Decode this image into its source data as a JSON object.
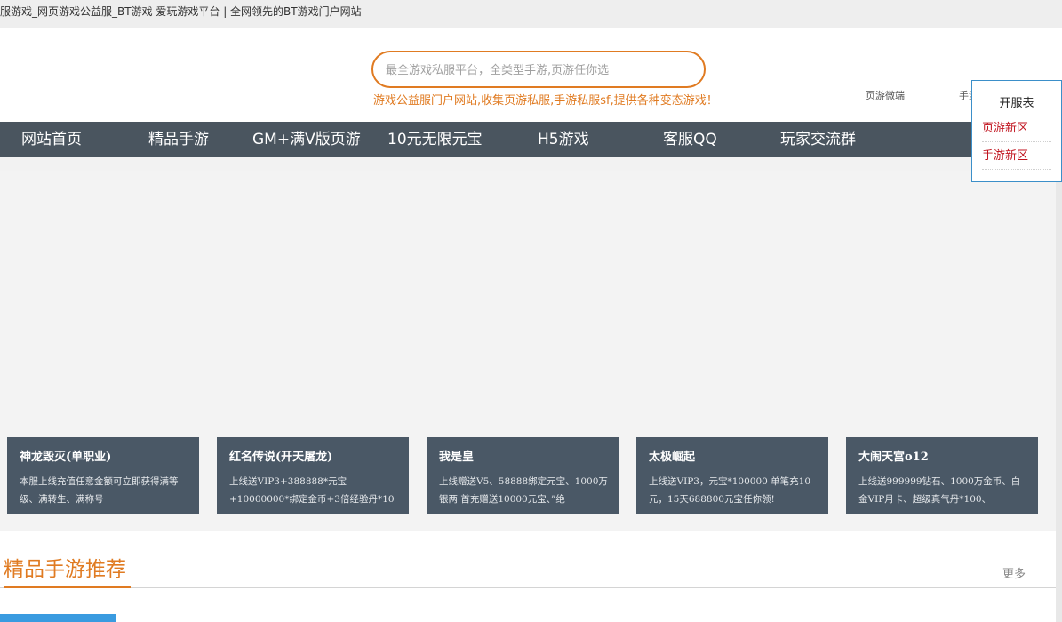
{
  "topbar": {
    "title": "服游戏_网页游戏公益服_BT游戏 爱玩游戏平台 | 全网领先的BT游戏门户网站"
  },
  "search": {
    "placeholder": "最全游戏私服平台，全类型手游,页游任你选"
  },
  "slogan": "游戏公益服门户网站,收集页游私服,手游私服sf,提供各种变态游戏！",
  "header_links": [
    "页游微端",
    "手游"
  ],
  "nav": [
    "网站首页",
    "精品手游",
    "GM+满V版页游",
    "10元无限元宝",
    "H5游戏",
    "客服QQ",
    "玩家交流群"
  ],
  "popup": {
    "title": "开服表",
    "links": [
      "页游新区",
      "手游新区"
    ]
  },
  "cards": [
    {
      "title": "神龙毁灭(单职业)",
      "desc": "本服上线充值任意金额可立即获得满等级、满转生、满称号"
    },
    {
      "title": "红名传说(开天屠龙)",
      "desc": "上线送VIP3+388888*元宝+10000000*绑定金币+3倍经验丹*10"
    },
    {
      "title": "我是皇",
      "desc": "上线赠送V5、58888绑定元宝、1000万银两 首充赠送10000元宝、”绝"
    },
    {
      "title": "太极崛起",
      "desc": "上线送VIP3，元宝*100000 单笔充10元，15天688800元宝任你领!"
    },
    {
      "title": "大闹天宫o12",
      "desc": "上线送999999钻石、1000万金币、白金VIP月卡、超级真气丹*100、"
    }
  ],
  "section": {
    "title": "精品手游推荐",
    "more": "更多"
  },
  "colors": {
    "accent": "#e07b22",
    "nav_bg": "#4a555f",
    "card_bg": "#4a5866",
    "popup_link": "#c0121d",
    "popup_border": "#3b8fc9",
    "tab_blue": "#3a9be0"
  }
}
